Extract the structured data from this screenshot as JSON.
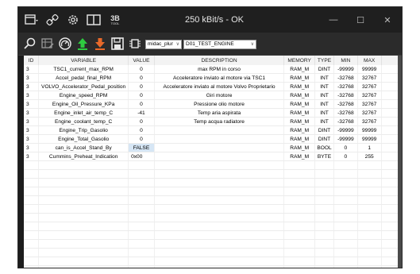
{
  "titlebar": {
    "status": "250 kBit/s - OK",
    "icons": [
      "layout-dropdown-icon",
      "link-icon",
      "settings-icon",
      "panel-icon",
      "3b-tool-icon"
    ],
    "tool_logo_top": "3B",
    "tool_logo_bottom": "TOOL",
    "minimize": "—",
    "maximize": "☐",
    "close": "✕"
  },
  "toolbar": {
    "protocol_select": "midac_plur",
    "engine_select": "D01_TEST_ENGINE"
  },
  "table": {
    "headers": [
      "ID",
      "VARIABLE",
      "VALUE",
      "DESCRIPTION",
      "MEMORY",
      "TYPE",
      "MIN",
      "MAX"
    ],
    "rows": [
      {
        "id": "3",
        "variable": "TSC1_current_max_RPM",
        "value": "0",
        "description": "max RPM in corso",
        "memory": "RAM_M",
        "type": "DINT",
        "min": "-99999",
        "max": "99999"
      },
      {
        "id": "3",
        "variable": "Accel_pedal_final_RPM",
        "value": "0",
        "description": "Acceleratore inviato al motore via TSC1",
        "memory": "RAM_M",
        "type": "INT",
        "min": "-32768",
        "max": "32767"
      },
      {
        "id": "3",
        "variable": "VOLVO_Accelerator_Pedal_position",
        "value": "0",
        "description": "Acceleratore inviato al motore Volvo Proprietario",
        "memory": "RAM_M",
        "type": "INT",
        "min": "-32768",
        "max": "32767"
      },
      {
        "id": "3",
        "variable": "Engine_speed_RPM",
        "value": "0",
        "description": "Giri motore",
        "memory": "RAM_M",
        "type": "INT",
        "min": "-32768",
        "max": "32767"
      },
      {
        "id": "3",
        "variable": "Engine_Oil_Pressure_KPa",
        "value": "0",
        "description": "Pressione olio motore",
        "memory": "RAM_M",
        "type": "INT",
        "min": "-32768",
        "max": "32767"
      },
      {
        "id": "3",
        "variable": "Engine_inlet_air_temp_C",
        "value": "-41",
        "description": "Temp aria aspirata",
        "memory": "RAM_M",
        "type": "INT",
        "min": "-32768",
        "max": "32767"
      },
      {
        "id": "3",
        "variable": "Engine_coolant_temp_C",
        "value": "0",
        "description": "Temp acqua radiatore",
        "memory": "RAM_M",
        "type": "INT",
        "min": "-32768",
        "max": "32767"
      },
      {
        "id": "3",
        "variable": "Engine_Trip_Gasolio",
        "value": "0",
        "description": "",
        "memory": "RAM_M",
        "type": "DINT",
        "min": "-99999",
        "max": "99999"
      },
      {
        "id": "3",
        "variable": "Engine_Total_Gasolio",
        "value": "0",
        "description": "",
        "memory": "RAM_M",
        "type": "DINT",
        "min": "-99999",
        "max": "99999"
      },
      {
        "id": "3",
        "variable": "can_is_Accel_Stand_By",
        "value": "FALSE",
        "description": "",
        "memory": "RAM_M",
        "type": "BOOL",
        "min": "0",
        "max": "1"
      },
      {
        "id": "3",
        "variable": "Cummins_Preheat_Indication",
        "value": "0x00",
        "description": "",
        "memory": "RAM_M",
        "type": "BYTE",
        "min": "0",
        "max": "255"
      }
    ]
  },
  "colors": {
    "titlebar_bg": "#1f1f1f",
    "toolbar_bg": "#2b2b2b",
    "upload_green": "#2ecc40",
    "download_orange": "#e8692a",
    "selected_cell": "#d6e6f5"
  }
}
